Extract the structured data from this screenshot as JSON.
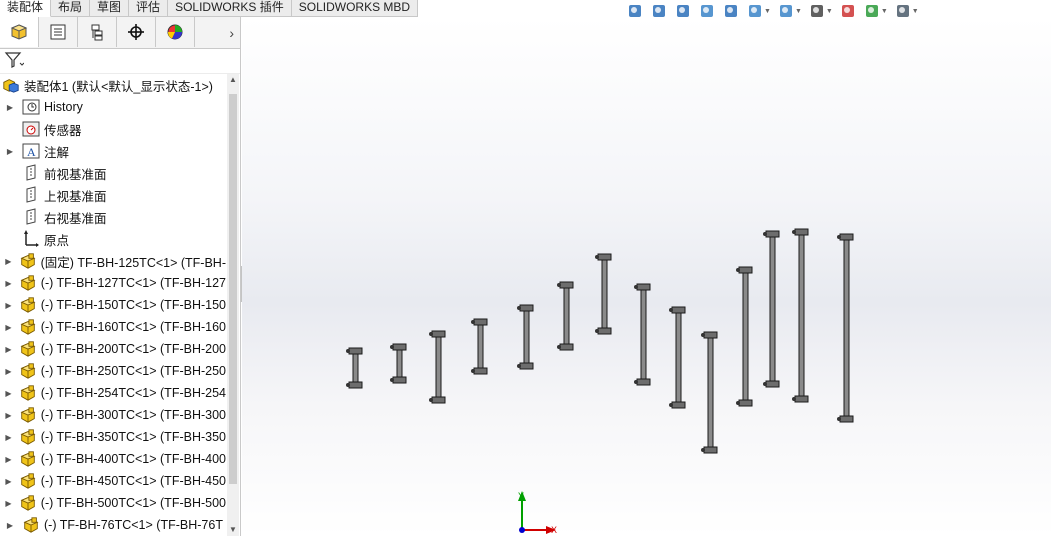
{
  "command_tabs": [
    "装配体",
    "布局",
    "草图",
    "评估",
    "SOLIDWORKS 插件",
    "SOLIDWORKS MBD"
  ],
  "active_tab": "装配体",
  "panel_tabs": [
    "featuremanager-icon",
    "propertymanager-icon",
    "configurationmanager-icon",
    "dimxpert-icon",
    "display-manager-icon"
  ],
  "panel_more": "›",
  "tree": {
    "root": "装配体1  (默认<默认_显示状态-1>)",
    "items": [
      {
        "label": "History",
        "icon": "history-icon",
        "expandable": true
      },
      {
        "label": "传感器",
        "icon": "sensor-icon",
        "expandable": false
      },
      {
        "label": "注解",
        "icon": "annotation-icon",
        "expandable": true
      },
      {
        "label": "前视基准面",
        "icon": "plane-icon",
        "expandable": false
      },
      {
        "label": "上视基准面",
        "icon": "plane-icon",
        "expandable": false
      },
      {
        "label": "右视基准面",
        "icon": "plane-icon",
        "expandable": false
      },
      {
        "label": "原点",
        "icon": "origin-icon",
        "expandable": false
      },
      {
        "label": "(固定) TF-BH-125TC<1> (TF-BH-",
        "icon": "part-icon",
        "expandable": true
      },
      {
        "label": "(-) TF-BH-127TC<1> (TF-BH-127",
        "icon": "part-icon",
        "expandable": true
      },
      {
        "label": "(-) TF-BH-150TC<1> (TF-BH-150",
        "icon": "part-icon",
        "expandable": true
      },
      {
        "label": "(-) TF-BH-160TC<1> (TF-BH-160",
        "icon": "part-icon",
        "expandable": true
      },
      {
        "label": "(-) TF-BH-200TC<1> (TF-BH-200",
        "icon": "part-icon",
        "expandable": true
      },
      {
        "label": "(-) TF-BH-250TC<1> (TF-BH-250",
        "icon": "part-icon",
        "expandable": true
      },
      {
        "label": "(-) TF-BH-254TC<1> (TF-BH-254",
        "icon": "part-icon",
        "expandable": true
      },
      {
        "label": "(-) TF-BH-300TC<1> (TF-BH-300",
        "icon": "part-icon",
        "expandable": true
      },
      {
        "label": "(-) TF-BH-350TC<1> (TF-BH-350",
        "icon": "part-icon",
        "expandable": true
      },
      {
        "label": "(-) TF-BH-400TC<1> (TF-BH-400",
        "icon": "part-icon",
        "expandable": true
      },
      {
        "label": "(-) TF-BH-450TC<1> (TF-BH-450",
        "icon": "part-icon",
        "expandable": true
      },
      {
        "label": "(-) TF-BH-500TC<1> (TF-BH-500",
        "icon": "part-icon",
        "expandable": true
      },
      {
        "label": "(-) TF-BH-76TC<1> (TF-BH-76T",
        "icon": "part-icon",
        "expandable": true
      }
    ]
  },
  "hud_icons": [
    "zoom-to-fit-icon",
    "zoom-area-icon",
    "previous-view-icon",
    "section-view-icon",
    "dynamic-annotation-icon",
    "view-orientation-icon",
    "display-style-icon",
    "hide-show-items-icon",
    "edit-appearance-icon",
    "apply-scene-icon",
    "view-settings-icon"
  ],
  "triad": {
    "y_label": "Y",
    "x_label": "X"
  },
  "colors": {
    "part_gray": "#555555",
    "part_yellow": "#f0c419",
    "axis_x": "#d00000",
    "axis_y": "#00a000",
    "axis_z": "#0000d0"
  }
}
